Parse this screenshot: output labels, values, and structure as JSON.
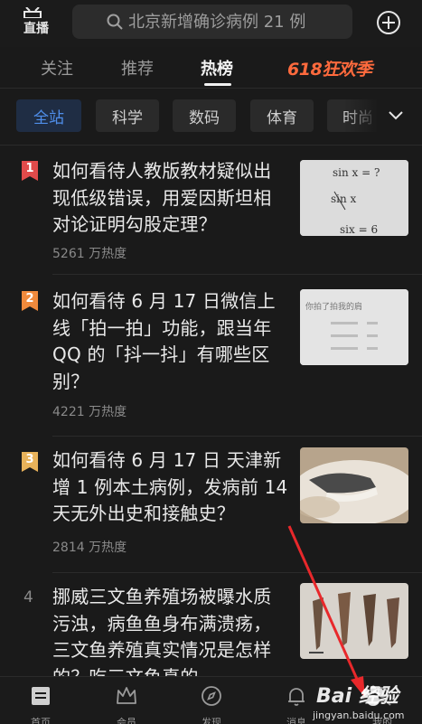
{
  "header": {
    "live_label": "直播",
    "search_placeholder": "北京新增确诊病例 21 例"
  },
  "tabs": [
    {
      "label": "关注",
      "active": false
    },
    {
      "label": "推荐",
      "active": false
    },
    {
      "label": "热榜",
      "active": true
    }
  ],
  "promo_label": "618狂欢季",
  "categories": [
    {
      "label": "全站",
      "active": true
    },
    {
      "label": "科学",
      "active": false
    },
    {
      "label": "数码",
      "active": false
    },
    {
      "label": "体育",
      "active": false
    },
    {
      "label": "时尚",
      "active": false
    }
  ],
  "hot_list": [
    {
      "rank": "1",
      "title": "如何看待人教版教材疑似出现低级错误，用爱因斯坦相对论证明勾股定理？",
      "heat": "5261 万热度",
      "thumb_text": [
        "1/x sin x = ?",
        "1/x sin x",
        "six = 6"
      ]
    },
    {
      "rank": "2",
      "title": "如何看待 6 月 17 日微信上线「拍一拍」功能，跟当年 QQ 的「抖一抖」有哪些区别？",
      "heat": "4221 万热度",
      "thumb_text": [
        "你拍了拍我的肩"
      ]
    },
    {
      "rank": "3",
      "title": "如何看待 6 月 17 日 天津新增 1 例本土病例，发病前 14 天无外出史和接触史？",
      "heat": "2814 万热度"
    },
    {
      "rank": "4",
      "title": "挪威三文鱼养殖场被曝水质污浊，病鱼鱼身布满溃疡，三文鱼养殖真实情况是怎样的？吃三文鱼真的",
      "heat": ""
    }
  ],
  "colors": {
    "rank1": "#e24b4b",
    "rank2": "#f08a3c",
    "rank3": "#e8b25a",
    "accent": "#4f8eea",
    "promo": "#ff6a3d"
  },
  "bottom_nav": [
    {
      "label": "首页",
      "icon": "home-icon"
    },
    {
      "label": "会员",
      "icon": "crown-icon"
    },
    {
      "label": "发现",
      "icon": "compass-icon"
    },
    {
      "label": "消息",
      "icon": "bell-icon"
    },
    {
      "label": "我的",
      "icon": "profile-icon"
    }
  ],
  "watermark": {
    "brand": "Bai 经验",
    "url": "jingyan.baidu.com"
  }
}
